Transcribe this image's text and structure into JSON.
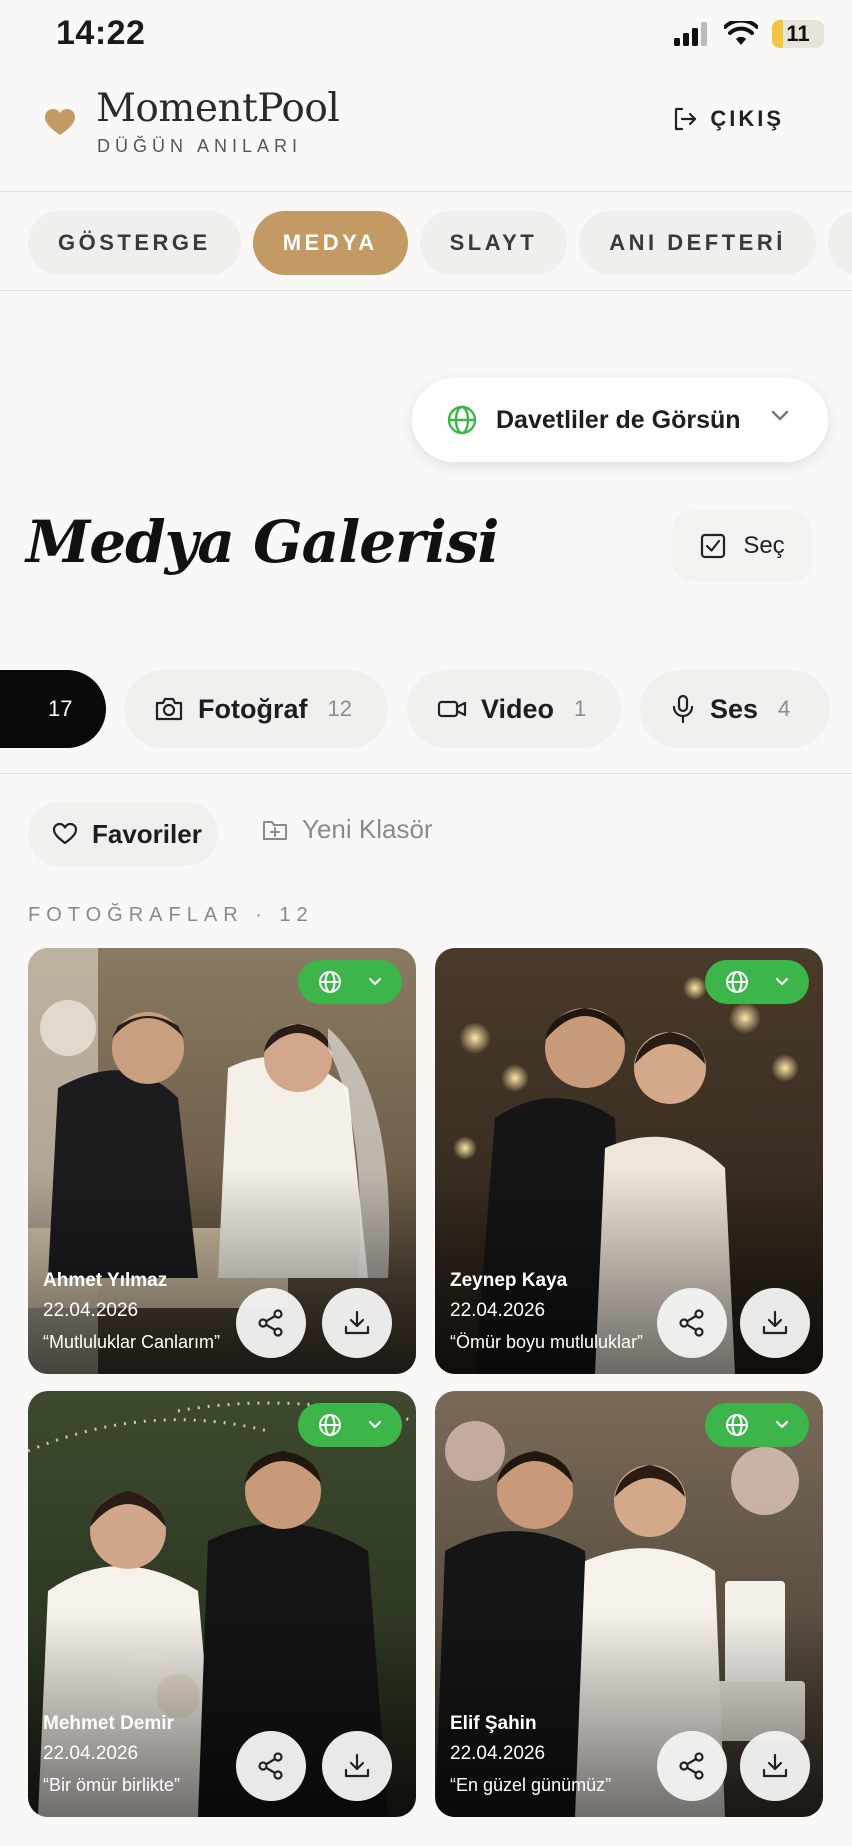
{
  "status_bar": {
    "time": "14:22",
    "battery": "11"
  },
  "header": {
    "brand_name": "MomentPool",
    "brand_sub": "DÜĞÜN ANILARI",
    "logout_label": "ÇIKIŞ"
  },
  "nav": {
    "tabs": [
      {
        "label": "GÖSTERGE"
      },
      {
        "label": "MEDYA",
        "active": true
      },
      {
        "label": "SLAYT"
      },
      {
        "label": "ANI DEFTERİ"
      }
    ]
  },
  "visibility": {
    "label": "Davetliler de Görsün"
  },
  "page": {
    "title": "Medya Galerisi",
    "select_label": "Seç"
  },
  "filters": {
    "all_count": "17",
    "items": [
      {
        "label": "Fotoğraf",
        "count": "12"
      },
      {
        "label": "Video",
        "count": "1"
      },
      {
        "label": "Ses",
        "count": "4"
      }
    ]
  },
  "actions": {
    "favorites_label": "Favoriler",
    "new_folder_label": "Yeni Klasör"
  },
  "section": {
    "label": "FOTOĞRAFLAR · 12"
  },
  "cards": [
    {
      "author": "Ahmet Yılmaz",
      "date": "22.04.2026",
      "caption": "“Mutluluklar Canlarım”"
    },
    {
      "author": "Zeynep Kaya",
      "date": "22.04.2026",
      "caption": "“Ömür boyu mutluluklar”"
    },
    {
      "author": "Mehmet Demir",
      "date": "22.04.2026",
      "caption": "“Bir ömür birlikte”"
    },
    {
      "author": "Elif Şahin",
      "date": "22.04.2026",
      "caption": "“En güzel günümüz”"
    }
  ],
  "colors": {
    "accent": "#c39a63",
    "visibility_green": "#3cb54a",
    "dark": "#0a0a0a"
  },
  "icons": [
    "heart-icon",
    "logout-icon",
    "globe-icon",
    "chevron-down-icon",
    "checkbox-icon",
    "camera-icon",
    "video-icon",
    "microphone-icon",
    "folder-plus-icon",
    "share-icon",
    "download-icon"
  ]
}
